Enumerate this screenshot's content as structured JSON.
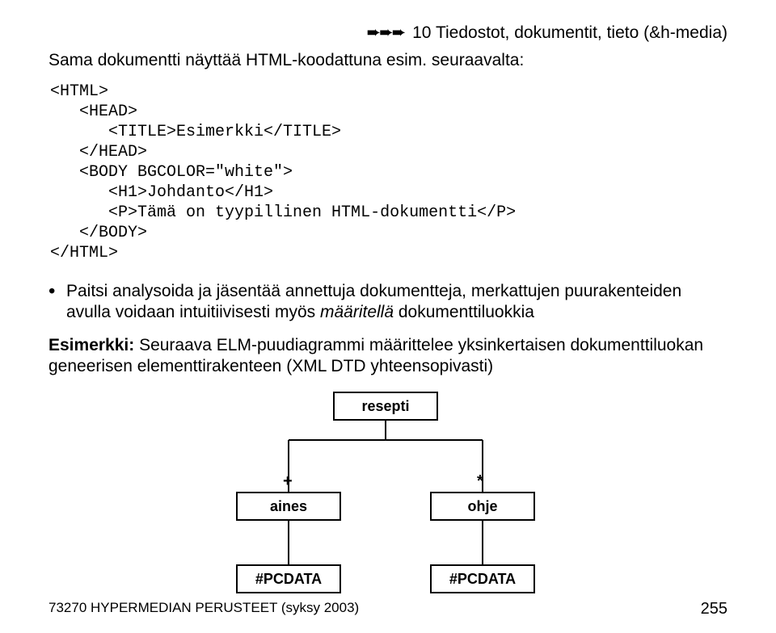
{
  "header": {
    "arrows": "➨➨➨",
    "text": "10 Tiedostot, dokumentit, tieto (&h-media)"
  },
  "intro": "Sama dokumentti näyttää HTML-koodattuna esim. seuraavalta:",
  "code": "<HTML>\n   <HEAD>\n      <TITLE>Esimerkki</TITLE>\n   </HEAD>\n   <BODY BGCOLOR=\"white\">\n      <H1>Johdanto</H1>\n      <P>Tämä on tyypillinen HTML-dokumentti</P>\n   </BODY>\n</HTML>",
  "bullet": {
    "pre": "Paitsi analysoida ja jäsentää annettuja dokumentteja, merkattujen puurakenteiden avulla voidaan intuitiivisesti myös ",
    "italic": "määritellä",
    "post": " dokumenttiluokkia"
  },
  "example": {
    "label": "Esimerkki:",
    "text": " Seuraava ELM-puudiagrammi määrittelee yksinkertaisen dokumenttiluokan geneerisen elementtirakenteen (XML DTD yhteensopivasti)"
  },
  "diagram": {
    "root": "resepti",
    "leftDecor": "+",
    "rightDecor": "*",
    "leftChild": "aines",
    "rightChild": "ohje",
    "leftLeaf": "#PCDATA",
    "rightLeaf": "#PCDATA"
  },
  "footer": {
    "left": "73270 HYPERMEDIAN PERUSTEET (syksy 2003)",
    "page": "255"
  }
}
